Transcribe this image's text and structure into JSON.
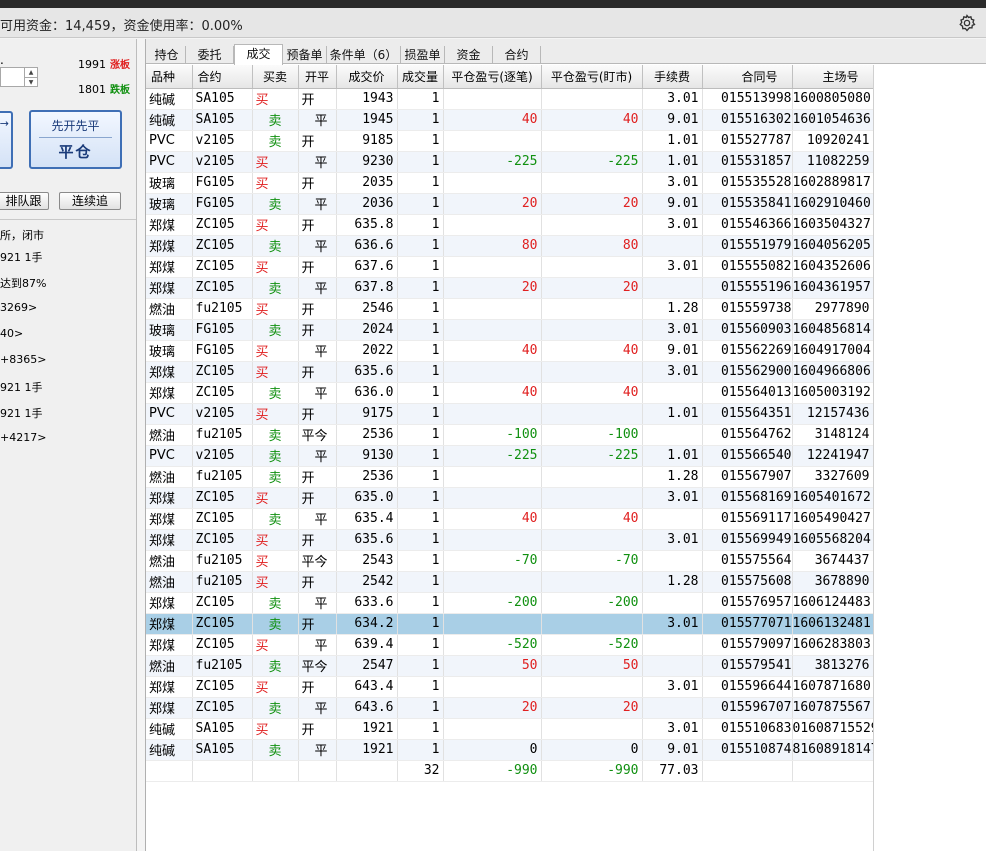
{
  "header": {
    "title": "可用资金：14,459，资金使用率：0.00%",
    "gear_icon": "gear-icon"
  },
  "left_panel": {
    "dot": ".",
    "price_up": "1991",
    "tag_up": "涨板",
    "price_down": "1801",
    "tag_down": "跌板",
    "side_button_label": "→",
    "main_button_line1": "先开先平",
    "main_button_line2": "平仓",
    "btn_queue": "排队跟",
    "btn_chase": "连续追",
    "messages": [
      "所，闭市",
      "921 1手",
      "达到87%",
      "3269>",
      "40>",
      "+8365>",
      "921 1手",
      "921 1手",
      "+4217>"
    ]
  },
  "tabs": [
    {
      "label": "持仓",
      "active": false
    },
    {
      "label": "委托",
      "active": false
    },
    {
      "label": "成交",
      "active": true
    },
    {
      "label": "预备单",
      "active": false
    },
    {
      "label": "条件单（6）",
      "active": false
    },
    {
      "label": "损盈单",
      "active": false
    },
    {
      "label": "资金",
      "active": false
    },
    {
      "label": "合约",
      "active": false
    }
  ],
  "columns": [
    "品种",
    "合约",
    "买卖",
    "开平",
    "成交价",
    "成交量",
    "平仓盈亏(逐笔)",
    "平仓盈亏(盯市)",
    "手续费",
    "合同号",
    "主场号"
  ],
  "rows": [
    [
      "纯碱",
      "SA105",
      "买",
      "开",
      "1943",
      "1",
      "",
      "",
      "3.01",
      "015513998",
      "1600805080"
    ],
    [
      "纯碱",
      "SA105",
      "卖",
      "平",
      "1945",
      "1",
      "40",
      "40",
      "9.01",
      "015516302",
      "1601054636"
    ],
    [
      "PVC",
      "v2105",
      "卖",
      "开",
      "9185",
      "1",
      "",
      "",
      "1.01",
      "015527787",
      "10920241"
    ],
    [
      "PVC",
      "v2105",
      "买",
      "平",
      "9230",
      "1",
      "-225",
      "-225",
      "1.01",
      "015531857",
      "11082259"
    ],
    [
      "玻璃",
      "FG105",
      "买",
      "开",
      "2035",
      "1",
      "",
      "",
      "3.01",
      "015535528",
      "1602889817"
    ],
    [
      "玻璃",
      "FG105",
      "卖",
      "平",
      "2036",
      "1",
      "20",
      "20",
      "9.01",
      "015535841",
      "1602910460"
    ],
    [
      "郑煤",
      "ZC105",
      "买",
      "开",
      "635.8",
      "1",
      "",
      "",
      "3.01",
      "015546366",
      "1603504327"
    ],
    [
      "郑煤",
      "ZC105",
      "卖",
      "平",
      "636.6",
      "1",
      "80",
      "80",
      "",
      "015551979",
      "1604056205"
    ],
    [
      "郑煤",
      "ZC105",
      "买",
      "开",
      "637.6",
      "1",
      "",
      "",
      "3.01",
      "015555082",
      "1604352606"
    ],
    [
      "郑煤",
      "ZC105",
      "卖",
      "平",
      "637.8",
      "1",
      "20",
      "20",
      "",
      "015555196",
      "1604361957"
    ],
    [
      "燃油",
      "fu2105",
      "买",
      "开",
      "2546",
      "1",
      "",
      "",
      "1.28",
      "015559738",
      "2977890"
    ],
    [
      "玻璃",
      "FG105",
      "卖",
      "开",
      "2024",
      "1",
      "",
      "",
      "3.01",
      "015560903",
      "1604856814"
    ],
    [
      "玻璃",
      "FG105",
      "买",
      "平",
      "2022",
      "1",
      "40",
      "40",
      "9.01",
      "015562269",
      "1604917004"
    ],
    [
      "郑煤",
      "ZC105",
      "买",
      "开",
      "635.6",
      "1",
      "",
      "",
      "3.01",
      "015562900",
      "1604966806"
    ],
    [
      "郑煤",
      "ZC105",
      "卖",
      "平",
      "636.0",
      "1",
      "40",
      "40",
      "",
      "015564013",
      "1605003192"
    ],
    [
      "PVC",
      "v2105",
      "买",
      "开",
      "9175",
      "1",
      "",
      "",
      "1.01",
      "015564351",
      "12157436"
    ],
    [
      "燃油",
      "fu2105",
      "卖",
      "平今",
      "2536",
      "1",
      "-100",
      "-100",
      "",
      "015564762",
      "3148124"
    ],
    [
      "PVC",
      "v2105",
      "卖",
      "平",
      "9130",
      "1",
      "-225",
      "-225",
      "1.01",
      "015566540",
      "12241947"
    ],
    [
      "燃油",
      "fu2105",
      "卖",
      "开",
      "2536",
      "1",
      "",
      "",
      "1.28",
      "015567907",
      "3327609"
    ],
    [
      "郑煤",
      "ZC105",
      "买",
      "开",
      "635.0",
      "1",
      "",
      "",
      "3.01",
      "015568169",
      "1605401672"
    ],
    [
      "郑煤",
      "ZC105",
      "卖",
      "平",
      "635.4",
      "1",
      "40",
      "40",
      "",
      "015569117",
      "1605490427"
    ],
    [
      "郑煤",
      "ZC105",
      "买",
      "开",
      "635.6",
      "1",
      "",
      "",
      "3.01",
      "015569949",
      "1605568204"
    ],
    [
      "燃油",
      "fu2105",
      "买",
      "平今",
      "2543",
      "1",
      "-70",
      "-70",
      "",
      "015575564",
      "3674437"
    ],
    [
      "燃油",
      "fu2105",
      "买",
      "开",
      "2542",
      "1",
      "",
      "",
      "1.28",
      "015575608",
      "3678890"
    ],
    [
      "郑煤",
      "ZC105",
      "卖",
      "平",
      "633.6",
      "1",
      "-200",
      "-200",
      "",
      "015576957",
      "1606124483"
    ],
    [
      "郑煤",
      "ZC105",
      "卖",
      "开",
      "634.2",
      "1",
      "",
      "",
      "3.01",
      "015577071",
      "1606132481"
    ],
    [
      "郑煤",
      "ZC105",
      "买",
      "平",
      "639.4",
      "1",
      "-520",
      "-520",
      "",
      "015579097",
      "1606283803"
    ],
    [
      "燃油",
      "fu2105",
      "卖",
      "平今",
      "2547",
      "1",
      "50",
      "50",
      "",
      "015579541",
      "3813276"
    ],
    [
      "郑煤",
      "ZC105",
      "买",
      "开",
      "643.4",
      "1",
      "",
      "",
      "3.01",
      "015596644",
      "1607871680"
    ],
    [
      "郑煤",
      "ZC105",
      "卖",
      "平",
      "643.6",
      "1",
      "20",
      "20",
      "",
      "015596707",
      "1607875567"
    ],
    [
      "纯碱",
      "SA105",
      "买",
      "开",
      "1921",
      "1",
      "",
      "",
      "3.01",
      "015510683",
      "01608715529"
    ],
    [
      "纯碱",
      "SA105",
      "卖",
      "平",
      "1921",
      "1",
      "0",
      "0",
      "9.01",
      "015510874",
      "81608918147"
    ]
  ],
  "selected_row": 25,
  "totals": {
    "volume": "32",
    "pnl_trade": "-990",
    "pnl_mark": "-990",
    "fee": "77.03"
  },
  "colors": {
    "buy": "#e02020",
    "sell": "#109010",
    "selected": "#a9cfe6"
  }
}
